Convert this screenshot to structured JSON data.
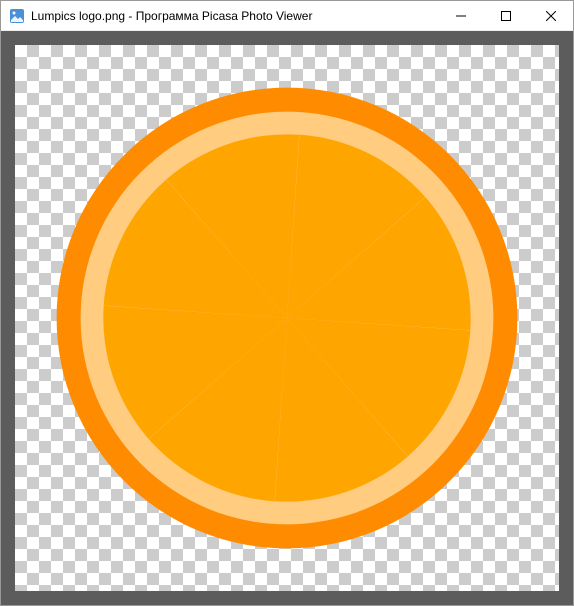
{
  "window": {
    "title": "Lumpics logo.png - Программа Picasa Photo Viewer"
  },
  "controls": {
    "minimize": "—",
    "maximize": "□",
    "close": "✕"
  },
  "image": {
    "name": "lumpics-logo",
    "description": "orange-citrus-slice",
    "colors": {
      "rind": "#FF8C00",
      "pith": "#FFCC80",
      "segments": "#FFA500"
    }
  }
}
